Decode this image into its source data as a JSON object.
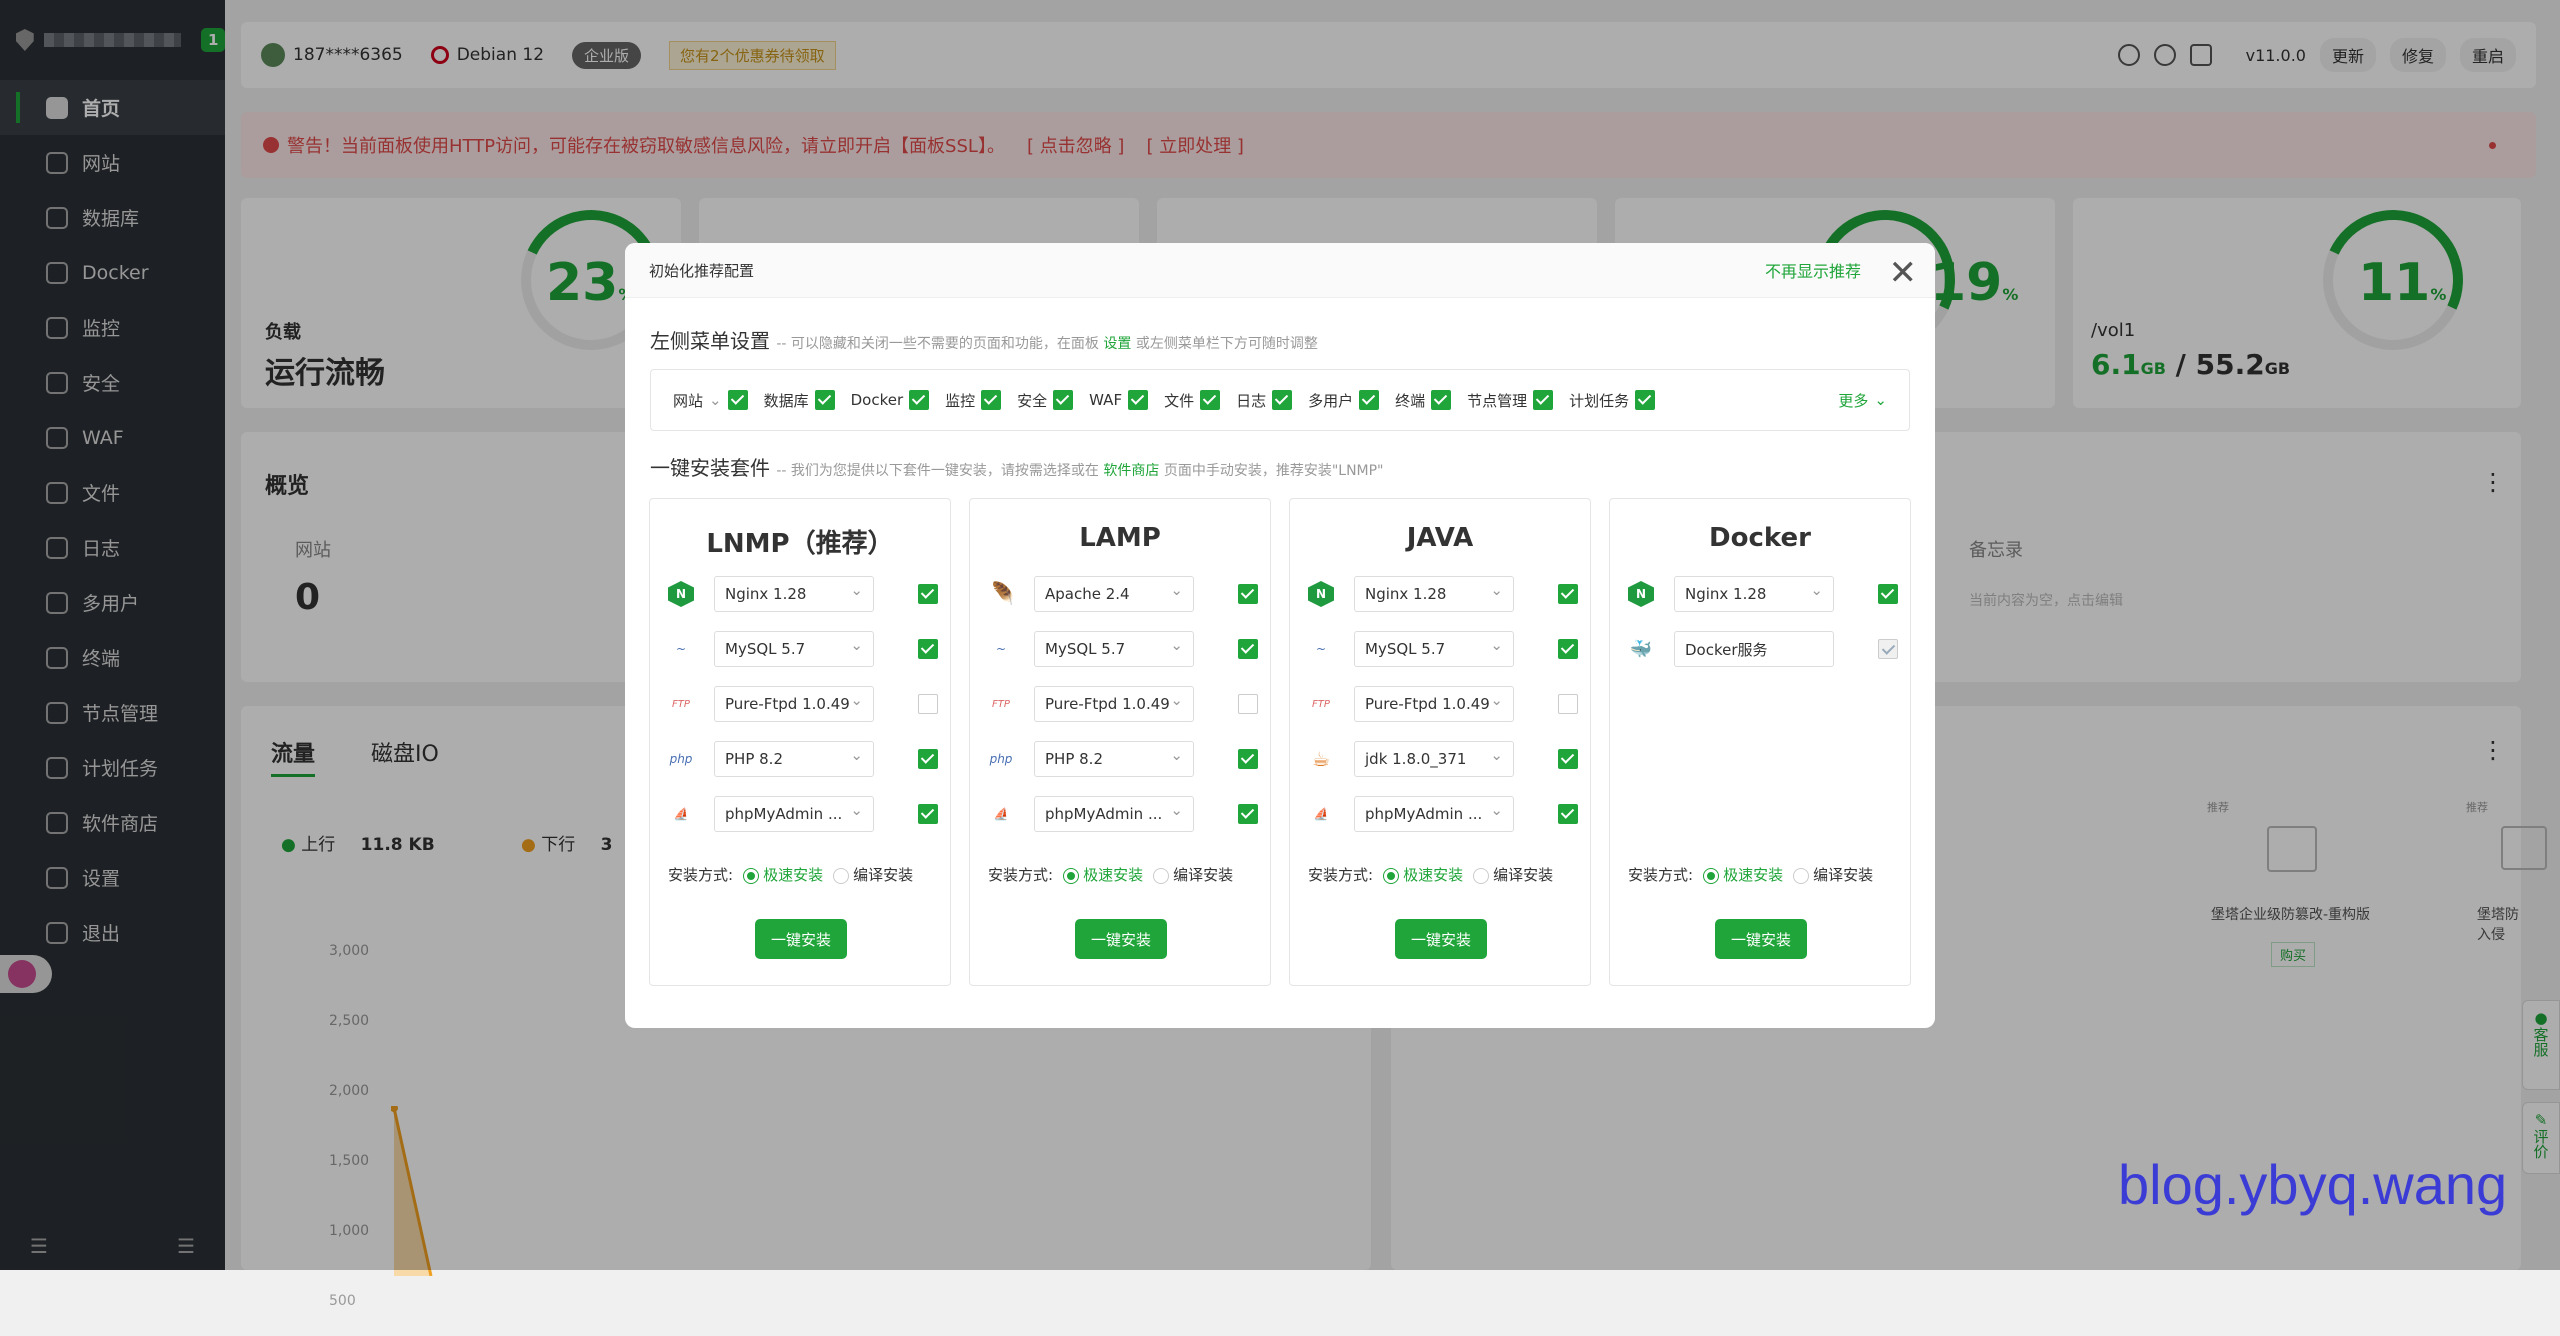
{
  "sidebar": {
    "badge": "1",
    "items": [
      {
        "label": "首页",
        "icon": "home-icon"
      },
      {
        "label": "网站",
        "icon": "website-icon"
      },
      {
        "label": "数据库",
        "icon": "database-icon"
      },
      {
        "label": "Docker",
        "icon": "docker-icon"
      },
      {
        "label": "监控",
        "icon": "monitor-icon"
      },
      {
        "label": "安全",
        "icon": "security-icon"
      },
      {
        "label": "WAF",
        "icon": "waf-icon"
      },
      {
        "label": "文件",
        "icon": "folder-icon"
      },
      {
        "label": "日志",
        "icon": "log-icon"
      },
      {
        "label": "多用户",
        "icon": "users-icon"
      },
      {
        "label": "终端",
        "icon": "terminal-icon"
      },
      {
        "label": "节点管理",
        "icon": "node-icon"
      },
      {
        "label": "计划任务",
        "icon": "calendar-icon"
      },
      {
        "label": "软件商店",
        "icon": "store-icon"
      },
      {
        "label": "设置",
        "icon": "gear-icon"
      },
      {
        "label": "退出",
        "icon": "logout-icon"
      }
    ]
  },
  "topbar": {
    "user": "187****6365",
    "os": "Debian 12",
    "edition": "企业版",
    "coupon": "您有2个优惠券待领取",
    "version": "v11.0.0",
    "update": "更新",
    "repair": "修复",
    "restart": "重启"
  },
  "alert": {
    "text": "警告！当前面板使用HTTP访问，可能存在被窃取敏感信息风险，请立即开启【面板SSL】。",
    "ignore": "[ 点击忽略 ]",
    "handle": "[ 立即处理 ]"
  },
  "stats": {
    "load_label": "负载",
    "load_status": "运行流畅",
    "load_pct": "23",
    "disk_pct": "19",
    "disk2_pct": "11",
    "vol": "/vol1",
    "disk_used": "6.1",
    "disk_total": "55.2",
    "disk_unit": "GB",
    "pct_sign": "%"
  },
  "overview": {
    "title": "概览",
    "site_label": "网站",
    "site_count": "0",
    "memo_label": "备忘录",
    "memo_placeholder": "当前内容为空，点击编辑"
  },
  "traffic": {
    "tab_flow": "流量",
    "tab_disk": "磁盘IO",
    "up_label": "上行",
    "up_value": "11.8 KB",
    "down_label": "下行",
    "down_value": "3",
    "y_ticks": [
      "3,000",
      "2,500",
      "2,000",
      "1,500",
      "1,000",
      "500"
    ]
  },
  "promo": {
    "tag": "推荐",
    "item1": "堡塔企业级防篡改-重构版",
    "item2": "堡塔防入侵",
    "buy": "购买"
  },
  "modal": {
    "title": "初始化推荐配置",
    "dismiss": "不再显示推荐",
    "menu_title": "左侧菜单设置",
    "menu_desc": "-- 可以隐藏和关闭一些不需要的页面和功能，在面板",
    "menu_link": "设置",
    "menu_desc2": "或左侧菜单栏下方可随时调整",
    "menu_items": [
      "网站",
      "数据库",
      "Docker",
      "监控",
      "安全",
      "WAF",
      "文件",
      "日志",
      "多用户",
      "终端",
      "节点管理",
      "计划任务"
    ],
    "more": "更多",
    "install_title": "一键安装套件",
    "install_desc": "-- 我们为您提供以下套件一键安装，请按需选择或在",
    "install_link": "软件商店",
    "install_desc2": "页面中手动安装，推荐安装\"LNMP\"",
    "method_label": "安装方式:",
    "fast": "极速安装",
    "compile": "编译安装",
    "install_btn": "一键安装",
    "packages": [
      {
        "name": "LNMP（推荐）",
        "rows": [
          "Nginx 1.28",
          "MySQL 5.7",
          "Pure-Ftpd 1.0.49",
          "PHP 8.2",
          "phpMyAdmin ..."
        ]
      },
      {
        "name": "LAMP",
        "rows": [
          "Apache 2.4",
          "MySQL 5.7",
          "Pure-Ftpd 1.0.49",
          "PHP 8.2",
          "phpMyAdmin ..."
        ]
      },
      {
        "name": "JAVA",
        "rows": [
          "Nginx 1.28",
          "MySQL 5.7",
          "Pure-Ftpd 1.0.49",
          "jdk 1.8.0_371",
          "phpMyAdmin ..."
        ]
      },
      {
        "name": "Docker",
        "rows": [
          "Nginx 1.28",
          "Docker服务"
        ]
      }
    ]
  },
  "sidetabs": {
    "service": "客服",
    "review": "评价"
  },
  "watermark": "blog.ybyq.wang"
}
